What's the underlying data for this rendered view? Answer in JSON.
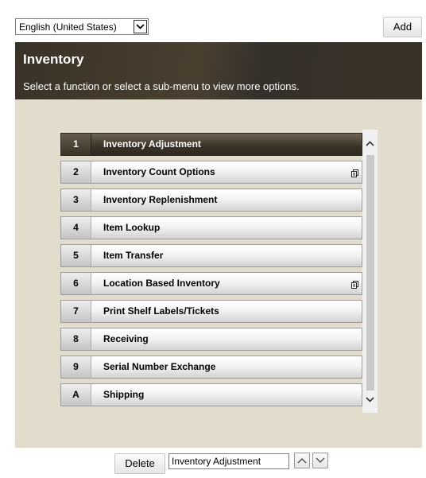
{
  "language_select": {
    "value": "English (United States)",
    "icon": "chevron-down-icon"
  },
  "toolbar": {
    "add_label": "Add"
  },
  "header": {
    "title": "Inventory",
    "description": "Select a function or select a sub-menu to view more options."
  },
  "menu": {
    "items": [
      {
        "key": "1",
        "label": "Inventory Adjustment",
        "has_submenu": false,
        "selected": true
      },
      {
        "key": "2",
        "label": "Inventory Count Options",
        "has_submenu": true,
        "selected": false
      },
      {
        "key": "3",
        "label": "Inventory Replenishment",
        "has_submenu": false,
        "selected": false
      },
      {
        "key": "4",
        "label": "Item Lookup",
        "has_submenu": false,
        "selected": false
      },
      {
        "key": "5",
        "label": "Item Transfer",
        "has_submenu": false,
        "selected": false
      },
      {
        "key": "6",
        "label": "Location Based Inventory",
        "has_submenu": true,
        "selected": false
      },
      {
        "key": "7",
        "label": "Print Shelf Labels/Tickets",
        "has_submenu": false,
        "selected": false
      },
      {
        "key": "8",
        "label": "Receiving",
        "has_submenu": false,
        "selected": false
      },
      {
        "key": "9",
        "label": "Serial Number Exchange",
        "has_submenu": false,
        "selected": false
      },
      {
        "key": "A",
        "label": "Shipping",
        "has_submenu": false,
        "selected": false
      }
    ]
  },
  "footer": {
    "delete_label": "Delete",
    "selected_name": "Inventory Adjustment",
    "move_up_icon": "chevron-up-icon",
    "move_down_icon": "chevron-down-icon"
  },
  "colors": {
    "header_bg": "#3a3227",
    "panel_bg": "#e2dccd",
    "selected_row": "#3a3227"
  }
}
